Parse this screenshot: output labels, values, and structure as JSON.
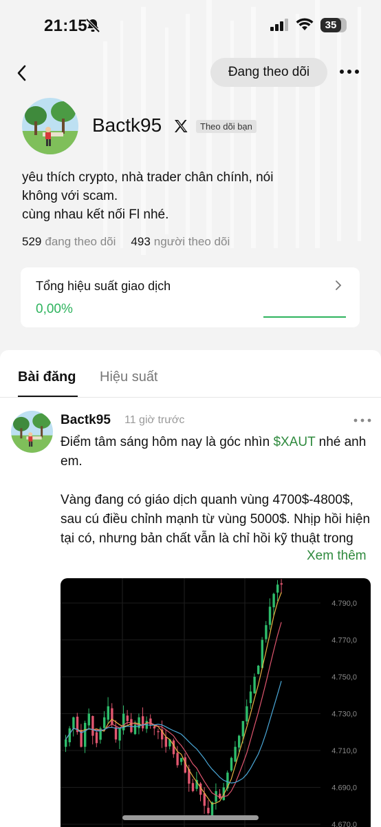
{
  "status_bar": {
    "time": "21:15",
    "battery": "35"
  },
  "header": {
    "follow_button": "Đang theo dõi"
  },
  "profile": {
    "username": "Bactk95",
    "follows_you_badge": "Theo dõi bạn",
    "bio_lines": [
      "yêu thích crypto, nhà trader chân chính, nói",
      "không với scam.",
      "cùng nhau kết nối Fl nhé."
    ],
    "following_count": "529",
    "following_label": "đang theo dõi",
    "followers_count": "493",
    "followers_label": "người theo dõi"
  },
  "performance_card": {
    "title": "Tổng hiệu suất giao dịch",
    "value": "0,00%"
  },
  "tabs": [
    {
      "label": "Bài đăng",
      "active": true
    },
    {
      "label": "Hiệu suất",
      "active": false
    }
  ],
  "post": {
    "author": "Bactk95",
    "time": "11 giờ trước",
    "line1_pre": "Điểm tâm sáng hôm nay là góc nhìn ",
    "ticker": "$XAUT",
    "line1_post": " nhé anh em.",
    "para2": "Vàng đang có giáo dịch quanh vùng 4700$-4800$, sau cú điều chỉnh mạnh từ vùng 5000$. Nhịp hồi hiện tại có, nhưng bản chất vẫn là chỉ hồi kỹ thuật trong bối  cảnh vĩ mô",
    "see_more": "Xem thêm"
  },
  "chart_data": {
    "type": "candlestick",
    "y_tick_labels": [
      "4.790,0",
      "4.770,0",
      "4.750,0",
      "4.730,0",
      "4.710,0",
      "4.690,0",
      "4.670,0"
    ],
    "ylim": [
      4665,
      4800
    ],
    "up_color": "#2ebd6b",
    "down_color": "#e0566f",
    "ma_colors": [
      "#e9b445",
      "#e0566f",
      "#4aa8d8"
    ]
  },
  "colors": {
    "accent_green": "#2db35d",
    "ticker_green": "#2f8a3e"
  }
}
